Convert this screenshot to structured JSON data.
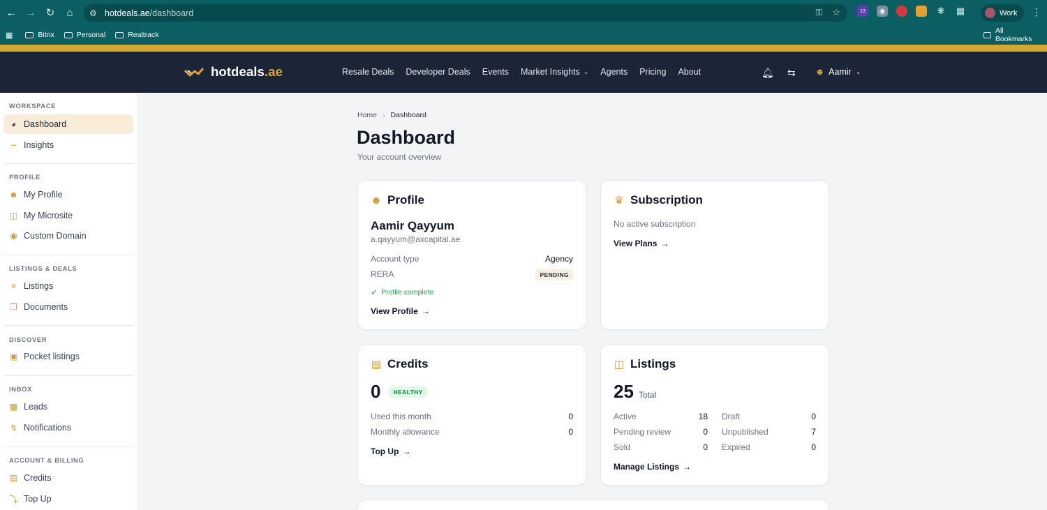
{
  "browser": {
    "url_host": "hotdeals.ae",
    "url_path": "/dashboard",
    "profile_label": "Work",
    "extension_badge": "13",
    "bookmarks": [
      "Bitrix",
      "Personal",
      "Realtrack"
    ],
    "all_bookmarks": "All Bookmarks"
  },
  "site": {
    "logo_name": "hotdeals",
    "logo_tld": ".ae",
    "nav": [
      "Resale Deals",
      "Developer Deals",
      "Events",
      "Market Insights",
      "Agents",
      "Pricing",
      "About"
    ],
    "user": "Aamir"
  },
  "sidebar": {
    "workspace_title": "WORKSPACE",
    "workspace": [
      "Dashboard",
      "Insights"
    ],
    "profile_title": "PROFILE",
    "profile": [
      "My Profile",
      "My Microsite",
      "Custom Domain"
    ],
    "listings_title": "LISTINGS & DEALS",
    "listings": [
      "Listings",
      "Documents"
    ],
    "discover_title": "DISCOVER",
    "discover": [
      "Pocket listings"
    ],
    "inbox_title": "INBOX",
    "inbox": [
      "Leads",
      "Notifications"
    ],
    "account_title": "ACCOUNT & BILLING",
    "account": [
      "Credits",
      "Top Up"
    ]
  },
  "breadcrumb": {
    "home": "Home",
    "current": "Dashboard"
  },
  "page": {
    "title": "Dashboard",
    "subtitle": "Your account overview"
  },
  "profile_card": {
    "title": "Profile",
    "name": "Aamir Qayyum",
    "email": "a.qayyum@axcapital.ae",
    "account_type_label": "Account type",
    "account_type_value": "Agency",
    "rera_label": "RERA",
    "rera_status": "PENDING",
    "complete_text": "Profile complete",
    "link": "View Profile"
  },
  "subscription_card": {
    "title": "Subscription",
    "status": "No active subscription",
    "link": "View Plans"
  },
  "credits_card": {
    "title": "Credits",
    "balance": "0",
    "health": "HEALTHY",
    "used_label": "Used this month",
    "used_value": "0",
    "allowance_label": "Monthly allowance",
    "allowance_value": "0",
    "link": "Top Up"
  },
  "listings_card": {
    "title": "Listings",
    "total": "25",
    "total_label": "Total",
    "active_label": "Active",
    "active_value": "18",
    "pending_label": "Pending review",
    "pending_value": "0",
    "sold_label": "Sold",
    "sold_value": "0",
    "draft_label": "Draft",
    "draft_value": "0",
    "unpublished_label": "Unpublished",
    "unpublished_value": "7",
    "expired_label": "Expired",
    "expired_value": "0",
    "link": "Manage Listings"
  },
  "colors": {
    "accent": "#d19a2c",
    "header": "#1b2537",
    "browser": "#0b5f62",
    "healthy": "#16a34a"
  }
}
